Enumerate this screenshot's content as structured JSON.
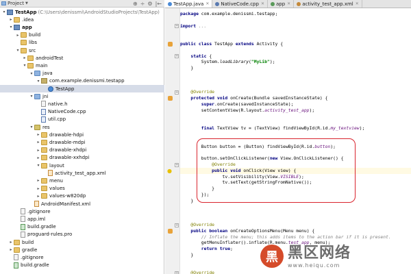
{
  "panel": {
    "title": "Project",
    "tools": [
      "⊕",
      "÷",
      "⚙",
      "|←"
    ]
  },
  "tree": [
    {
      "label": "TestApp",
      "path": "(C:\\Users\\denissmi\\AndroidStudioProjects\\TestApp)",
      "icon": "module",
      "indent": 0,
      "arrow": "▾",
      "bold": true
    },
    {
      "label": ".idea",
      "icon": "folder",
      "indent": 1,
      "arrow": "▸"
    },
    {
      "label": "app",
      "icon": "module",
      "indent": 1,
      "arrow": "▾",
      "bold": true
    },
    {
      "label": "build",
      "icon": "folder",
      "indent": 2,
      "arrow": "▸"
    },
    {
      "label": "libs",
      "icon": "folder",
      "indent": 2,
      "arrow": ""
    },
    {
      "label": "src",
      "icon": "folder",
      "indent": 2,
      "arrow": "▾"
    },
    {
      "label": "androidTest",
      "icon": "folder",
      "indent": 3,
      "arrow": "▸"
    },
    {
      "label": "main",
      "icon": "folder",
      "indent": 3,
      "arrow": "▾"
    },
    {
      "label": "java",
      "icon": "src-root",
      "indent": 4,
      "arrow": "▾"
    },
    {
      "label": "com.example.denissmi.testapp",
      "icon": "package",
      "indent": 5,
      "arrow": "▾"
    },
    {
      "label": "TestApp",
      "icon": "class",
      "indent": 6,
      "arrow": "",
      "selected": true
    },
    {
      "label": "jni",
      "icon": "src-root",
      "indent": 4,
      "arrow": "▾"
    },
    {
      "label": "native.h",
      "icon": "file",
      "indent": 5,
      "arrow": ""
    },
    {
      "label": "NativeCode.cpp",
      "icon": "file-cpp",
      "indent": 5,
      "arrow": ""
    },
    {
      "label": "util.cpp",
      "icon": "file-cpp",
      "indent": 5,
      "arrow": ""
    },
    {
      "label": "res",
      "icon": "res",
      "indent": 4,
      "arrow": "▾"
    },
    {
      "label": "drawable-hdpi",
      "icon": "folder",
      "indent": 5,
      "arrow": "▸"
    },
    {
      "label": "drawable-mdpi",
      "icon": "folder",
      "indent": 5,
      "arrow": "▸"
    },
    {
      "label": "drawable-xhdpi",
      "icon": "folder",
      "indent": 5,
      "arrow": "▸"
    },
    {
      "label": "drawable-xxhdpi",
      "icon": "folder",
      "indent": 5,
      "arrow": "▸"
    },
    {
      "label": "layout",
      "icon": "folder",
      "indent": 5,
      "arrow": "▾"
    },
    {
      "label": "activity_test_app.xml",
      "icon": "file-xml",
      "indent": 6,
      "arrow": ""
    },
    {
      "label": "menu",
      "icon": "folder",
      "indent": 5,
      "arrow": "▸"
    },
    {
      "label": "values",
      "icon": "folder",
      "indent": 5,
      "arrow": "▸"
    },
    {
      "label": "values-w820dp",
      "icon": "folder",
      "indent": 5,
      "arrow": "▸"
    },
    {
      "label": "AndroidManifest.xml",
      "icon": "file-xml",
      "indent": 4,
      "arrow": ""
    },
    {
      "label": ".gitignore",
      "icon": "file",
      "indent": 2,
      "arrow": ""
    },
    {
      "label": "app.iml",
      "icon": "file",
      "indent": 2,
      "arrow": ""
    },
    {
      "label": "build.gradle",
      "icon": "file-gradle",
      "indent": 2,
      "arrow": ""
    },
    {
      "label": "proguard-rules.pro",
      "icon": "file",
      "indent": 2,
      "arrow": ""
    },
    {
      "label": "build",
      "icon": "folder",
      "indent": 1,
      "arrow": "▸"
    },
    {
      "label": "gradle",
      "icon": "folder",
      "indent": 1,
      "arrow": "▸"
    },
    {
      "label": ".gitignore",
      "icon": "file",
      "indent": 1,
      "arrow": ""
    },
    {
      "label": "build.gradle",
      "icon": "file-gradle",
      "indent": 1,
      "arrow": ""
    }
  ],
  "tabs": [
    {
      "label": "TestApp.java",
      "icon_color": "#4a8ad6",
      "active": true
    },
    {
      "label": "NativeCode.cpp",
      "icon_color": "#5a7ab0",
      "active": false
    },
    {
      "label": "app",
      "icon_color": "#5a9a5a",
      "active": false
    },
    {
      "label": "activity_test_app.xml",
      "icon_color": "#c4893a",
      "active": false
    }
  ],
  "code": [
    {
      "tokens": [
        [
          "kw",
          "package"
        ],
        [
          "plain",
          " com.example.denissmi.testapp;"
        ]
      ]
    },
    {
      "tokens": []
    },
    {
      "tokens": [
        [
          "kw",
          "import"
        ],
        [
          "plain",
          " "
        ],
        [
          "cmt",
          "..."
        ]
      ],
      "fold": true
    },
    {
      "tokens": []
    },
    {
      "tokens": []
    },
    {
      "tokens": [
        [
          "kw",
          "public class"
        ],
        [
          "plain",
          " TestApp "
        ],
        [
          "kw",
          "extends"
        ],
        [
          "plain",
          " Activity {"
        ]
      ],
      "mark": "orange"
    },
    {
      "tokens": []
    },
    {
      "tokens": [
        [
          "plain",
          "    "
        ],
        [
          "kw",
          "static"
        ],
        [
          "plain",
          " {"
        ]
      ],
      "fold": true
    },
    {
      "tokens": [
        [
          "plain",
          "        System."
        ],
        [
          "ital",
          "loadLibrary"
        ],
        [
          "plain",
          "("
        ],
        [
          "str",
          "\"MyLib\""
        ],
        [
          "plain",
          ");"
        ]
      ]
    },
    {
      "tokens": [
        [
          "plain",
          "    }"
        ]
      ]
    },
    {
      "tokens": []
    },
    {
      "tokens": []
    },
    {
      "tokens": []
    },
    {
      "tokens": [
        [
          "ann",
          "    @Override"
        ]
      ],
      "fold": true
    },
    {
      "tokens": [
        [
          "plain",
          "    "
        ],
        [
          "kw",
          "protected void"
        ],
        [
          "plain",
          " onCreate(Bundle savedInstanceState) {"
        ]
      ],
      "mark": "orange"
    },
    {
      "tokens": [
        [
          "plain",
          "        "
        ],
        [
          "kw",
          "super"
        ],
        [
          "plain",
          ".onCreate(savedInstanceState);"
        ]
      ]
    },
    {
      "tokens": [
        [
          "plain",
          "        setContentView(R.layout."
        ],
        [
          "fld",
          "activity_test_app"
        ],
        [
          "plain",
          ");"
        ]
      ]
    },
    {
      "tokens": []
    },
    {
      "tokens": []
    },
    {
      "tokens": [
        [
          "plain",
          "        "
        ],
        [
          "kw",
          "final"
        ],
        [
          "plain",
          " TextView tv = (TextView) findViewById(R.id."
        ],
        [
          "fld",
          "my_textview"
        ],
        [
          "plain",
          ");"
        ]
      ]
    },
    {
      "tokens": []
    },
    {
      "tokens": []
    },
    {
      "tokens": [
        [
          "plain",
          "        Button button = (Button) findViewById(R.id."
        ],
        [
          "fld",
          "button"
        ],
        [
          "plain",
          ");"
        ]
      ]
    },
    {
      "tokens": []
    },
    {
      "tokens": [
        [
          "plain",
          "        button.setOnClickListener("
        ],
        [
          "kw",
          "new"
        ],
        [
          "plain",
          " View.OnClickListener() {"
        ]
      ]
    },
    {
      "tokens": [
        [
          "ann",
          "            @Override"
        ]
      ],
      "fold": true
    },
    {
      "tokens": [
        [
          "plain",
          "            "
        ],
        [
          "kw",
          "public void"
        ],
        [
          "plain",
          " onClick(View view) {"
        ]
      ],
      "mark": "bulb",
      "caret": true
    },
    {
      "tokens": [
        [
          "plain",
          "                tv.setVisibility(View."
        ],
        [
          "fld",
          "VISIBLE"
        ],
        [
          "plain",
          ");"
        ]
      ]
    },
    {
      "tokens": [
        [
          "plain",
          "                tv.setText(getStringFromNative());"
        ]
      ]
    },
    {
      "tokens": [
        [
          "plain",
          "            }"
        ]
      ]
    },
    {
      "tokens": [
        [
          "plain",
          "        });"
        ]
      ]
    },
    {
      "tokens": [
        [
          "plain",
          "    }"
        ]
      ]
    },
    {
      "tokens": []
    },
    {
      "tokens": []
    },
    {
      "tokens": []
    },
    {
      "tokens": [
        [
          "ann",
          "    @Override"
        ]
      ],
      "fold": true
    },
    {
      "tokens": [
        [
          "plain",
          "    "
        ],
        [
          "kw",
          "public boolean"
        ],
        [
          "plain",
          " onCreateOptionsMenu(Menu menu) {"
        ]
      ],
      "mark": "orange"
    },
    {
      "tokens": [
        [
          "cmt",
          "        // Inflate the menu; this adds items to the action bar if it is present."
        ]
      ]
    },
    {
      "tokens": [
        [
          "plain",
          "        getMenuInflater().inflate(R.menu."
        ],
        [
          "fld",
          "test_app"
        ],
        [
          "plain",
          ", menu);"
        ]
      ]
    },
    {
      "tokens": [
        [
          "plain",
          "        "
        ],
        [
          "kw",
          "return true"
        ],
        [
          "plain",
          ";"
        ]
      ]
    },
    {
      "tokens": [
        [
          "plain",
          "    }"
        ]
      ]
    },
    {
      "tokens": []
    },
    {
      "tokens": []
    },
    {
      "tokens": [
        [
          "ann",
          "    @Override"
        ]
      ],
      "fold": true
    }
  ],
  "watermark": {
    "logo": "黑",
    "title": "黑区网络",
    "domain": "www.heiqu.com"
  }
}
